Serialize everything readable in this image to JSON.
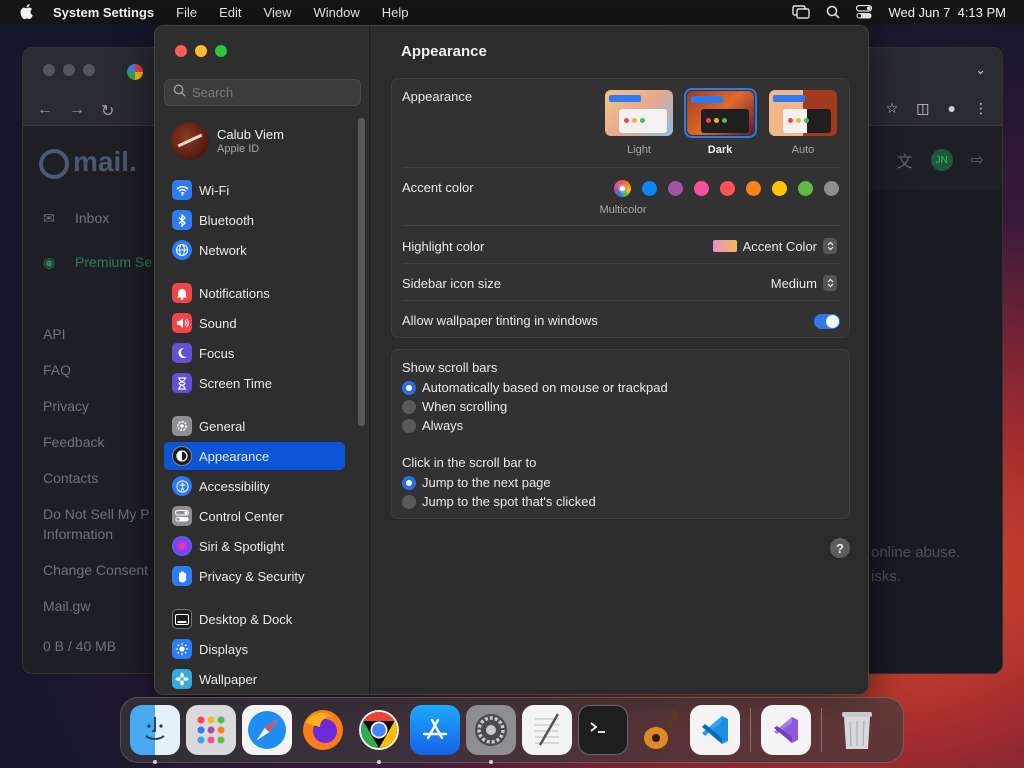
{
  "menubar": {
    "app_name": "System Settings",
    "items": [
      "File",
      "Edit",
      "View",
      "Window",
      "Help"
    ],
    "clock": "Wed Jun 7  4:13 PM"
  },
  "browser": {
    "logo": "mail.",
    "links": [
      "Inbox",
      "Premium Se",
      "API",
      "FAQ",
      "Privacy",
      "Feedback",
      "Contacts",
      "Do Not Sell My P",
      "Information",
      "Change Consent",
      "Mail.gw",
      "0 B / 40 MB"
    ],
    "avatar_initials": "JN",
    "body_lines": [
      "online abuse.",
      "isks."
    ]
  },
  "sidebar": {
    "search_placeholder": "Search",
    "account": {
      "name": "Calub Viem",
      "sub": "Apple ID"
    },
    "items": [
      {
        "label": "Wi-Fi",
        "color": "#2d7cf6"
      },
      {
        "label": "Bluetooth",
        "color": "#2d7cf6"
      },
      {
        "label": "Network",
        "color": "#2d7cf6"
      },
      {
        "label": "Notifications",
        "color": "#f0454a"
      },
      {
        "label": "Sound",
        "color": "#f0454a"
      },
      {
        "label": "Focus",
        "color": "#6151d6"
      },
      {
        "label": "Screen Time",
        "color": "#6151d6"
      },
      {
        "label": "General",
        "color": "#8e8e93"
      },
      {
        "label": "Appearance",
        "color": "#1c1c1e"
      },
      {
        "label": "Accessibility",
        "color": "#2d7cf6"
      },
      {
        "label": "Control Center",
        "color": "#8e8e93"
      },
      {
        "label": "Siri & Spotlight",
        "color": "#a347c9"
      },
      {
        "label": "Privacy & Security",
        "color": "#2d7cf6"
      },
      {
        "label": "Desktop & Dock",
        "color": "#1c1c1e"
      },
      {
        "label": "Displays",
        "color": "#2d7cf6"
      },
      {
        "label": "Wallpaper",
        "color": "#35aadc"
      }
    ],
    "selected": "Appearance"
  },
  "content": {
    "title": "Appearance",
    "appearance_label": "Appearance",
    "modes": [
      "Light",
      "Dark",
      "Auto"
    ],
    "selected_mode": "Dark",
    "accent_label": "Accent color",
    "accent_selected_name": "Multicolor",
    "accent_colors": [
      "#0a84ff",
      "#a550a7",
      "#f74f9e",
      "#ff5257",
      "#f7821b",
      "#ffc600",
      "#62ba46",
      "#8c8c8c"
    ],
    "highlight_label": "Highlight color",
    "highlight_value": "Accent Color",
    "sidebar_icon_label": "Sidebar icon size",
    "sidebar_icon_value": "Medium",
    "tinting_label": "Allow wallpaper tinting in windows",
    "tinting_on": true,
    "scrollbars_label": "Show scroll bars",
    "scrollbar_options": [
      "Automatically based on mouse or trackpad",
      "When scrolling",
      "Always"
    ],
    "scrollbar_selected": 0,
    "click_label": "Click in the scroll bar to",
    "click_options": [
      "Jump to the next page",
      "Jump to the spot that's clicked"
    ],
    "click_selected": 0,
    "help": "?"
  },
  "dock": {
    "apps": [
      "finder",
      "launchpad",
      "safari",
      "firefox",
      "chrome",
      "app-store",
      "system-settings",
      "textedit",
      "terminal",
      "garageband",
      "vscode",
      "visual-studio",
      "trash"
    ]
  }
}
